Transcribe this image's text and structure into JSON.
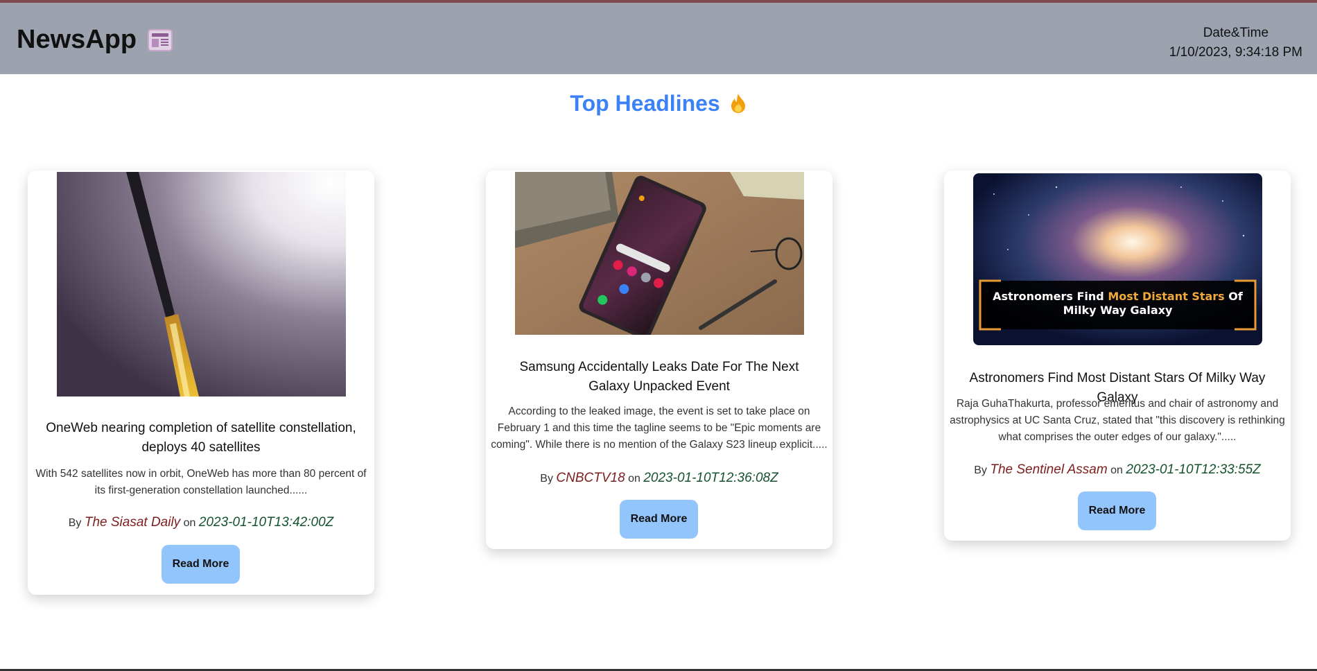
{
  "navbar": {
    "brand": "NewsApp",
    "brand_icon": "newspaper-icon",
    "datetime_label": "Date&Time",
    "datetime_value": "1/10/2023, 9:34:18 PM"
  },
  "section": {
    "title": "Top Headlines",
    "icon": "fire-icon"
  },
  "articles": [
    {
      "title": "OneWeb nearing completion of satellite constellation, deploys 40 satellites",
      "description": "With 542 satellites now in orbit, OneWeb has more than 80 percent of its first-generation constellation launched......",
      "by": "By",
      "source": "The Siasat Daily",
      "on": "on",
      "date": "2023-01-10T13:42:00Z",
      "button": "Read More"
    },
    {
      "title": "Samsung Accidentally Leaks Date For The Next Galaxy Unpacked Event",
      "description": "According to the leaked image, the event is set to take place on February 1 and this time the tagline seems to be \"Epic moments are coming\". While there is no mention of the Galaxy S23 lineup explicit.....",
      "by": "By",
      "source": "CNBCTV18",
      "on": "on",
      "date": "2023-01-10T12:36:08Z",
      "button": "Read More"
    },
    {
      "title": "Astronomers Find Most Distant Stars Of Milky Way Galaxy",
      "description": "Raja GuhaThakurta, professor emeritus and chair of astronomy and astrophysics at UC Santa Cruz, stated that \"this discovery is rethinking what comprises the outer edges of our galaxy.\".....",
      "by": "By",
      "source": "The Sentinel Assam",
      "on": "on",
      "date": "2023-01-10T12:33:55Z",
      "button": "Read More",
      "image_caption_pre": "Astronomers Find",
      "image_caption_highlight": "Most Distant Stars",
      "image_caption_post": "Of Milky Way Galaxy"
    }
  ]
}
